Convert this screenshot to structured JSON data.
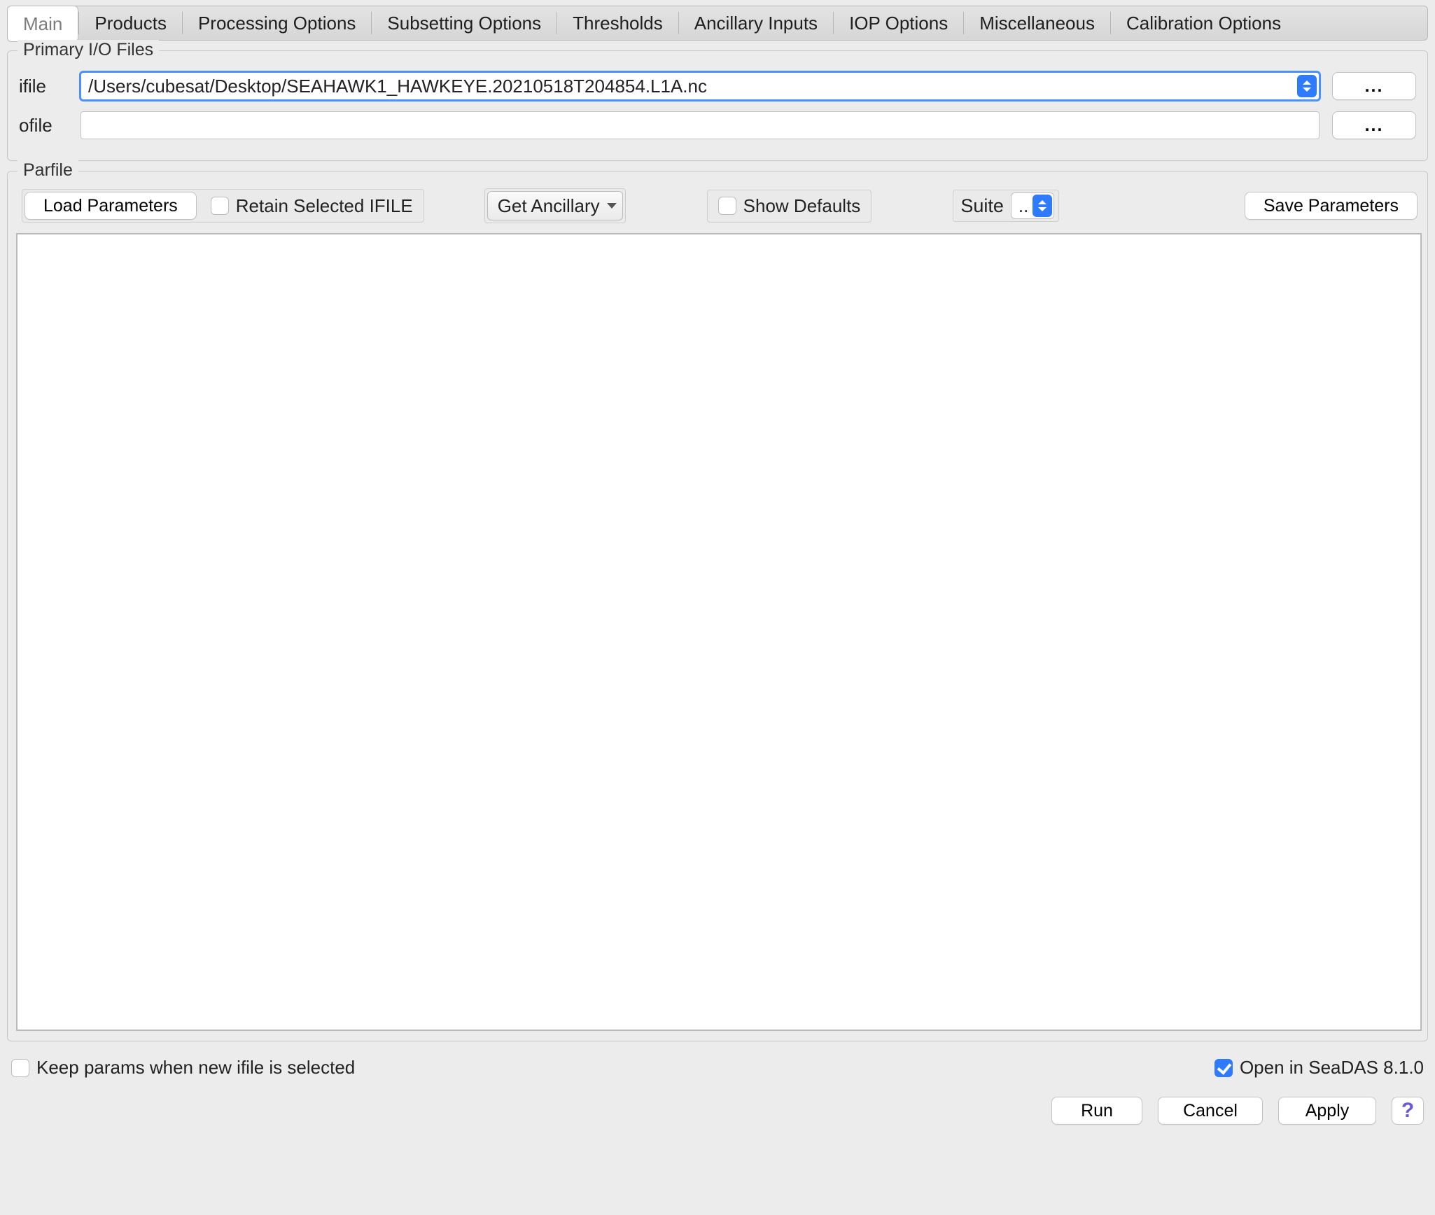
{
  "tabs": {
    "main": {
      "label": "Main"
    },
    "products": {
      "label": "Products"
    },
    "processing": {
      "label": "Processing Options"
    },
    "subsetting": {
      "label": "Subsetting Options"
    },
    "thresholds": {
      "label": "Thresholds"
    },
    "ancillary": {
      "label": "Ancillary Inputs"
    },
    "iop": {
      "label": "IOP Options"
    },
    "misc": {
      "label": "Miscellaneous"
    },
    "calibration": {
      "label": "Calibration Options"
    }
  },
  "io": {
    "group_title": "Primary I/O Files",
    "ifile_label": "ifile",
    "ifile_value": "/Users/cubesat/Desktop/SEAHAWK1_HAWKEYE.20210518T204854.L1A.nc",
    "ofile_label": "ofile",
    "ofile_value": "",
    "browse_label": "..."
  },
  "parfile": {
    "group_title": "Parfile",
    "load_label": "Load Parameters",
    "retain_label": "Retain Selected IFILE",
    "get_anc_label": "Get Ancillary",
    "show_defaults_label": "Show Defaults",
    "suite_label": "Suite",
    "suite_value": "..",
    "save_label": "Save Parameters",
    "textarea_value": ""
  },
  "bottom": {
    "keep_params_label": "Keep params when new ifile is selected",
    "open_in_seadas_label": "Open in SeaDAS 8.1.0"
  },
  "actions": {
    "run": "Run",
    "cancel": "Cancel",
    "apply": "Apply",
    "help": "?"
  }
}
